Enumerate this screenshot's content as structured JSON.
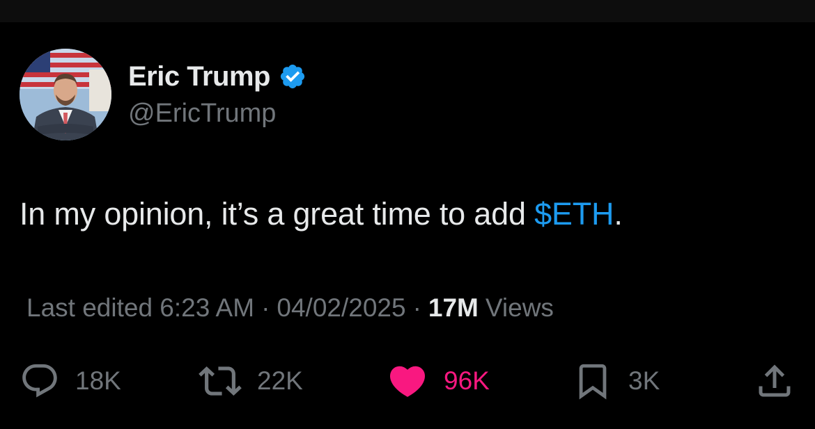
{
  "author": {
    "display_name": "Eric Trump",
    "handle": "@EricTrump",
    "verified": true,
    "avatar_icon": "profile-photo-avatar"
  },
  "tweet": {
    "text_before": "In my opinion, it’s a great time to add ",
    "cashtag": "$ETH",
    "text_after": "."
  },
  "meta": {
    "edited_label": "Last edited 6:23 AM",
    "separator": "·",
    "date": "04/02/2025",
    "views_count": "17M",
    "views_label": "Views"
  },
  "actions": {
    "reply": {
      "icon": "reply-icon",
      "count": "18K"
    },
    "repost": {
      "icon": "repost-icon",
      "count": "22K"
    },
    "like": {
      "icon": "heart-icon",
      "count": "96K",
      "liked": true
    },
    "bookmark": {
      "icon": "bookmark-icon",
      "count": "3K"
    },
    "share": {
      "icon": "share-icon"
    }
  },
  "colors": {
    "background": "#000000",
    "primary_text": "#e7e9ea",
    "secondary_text": "#71767b",
    "accent_blue": "#1d9bf0",
    "like_pink": "#f91880"
  }
}
